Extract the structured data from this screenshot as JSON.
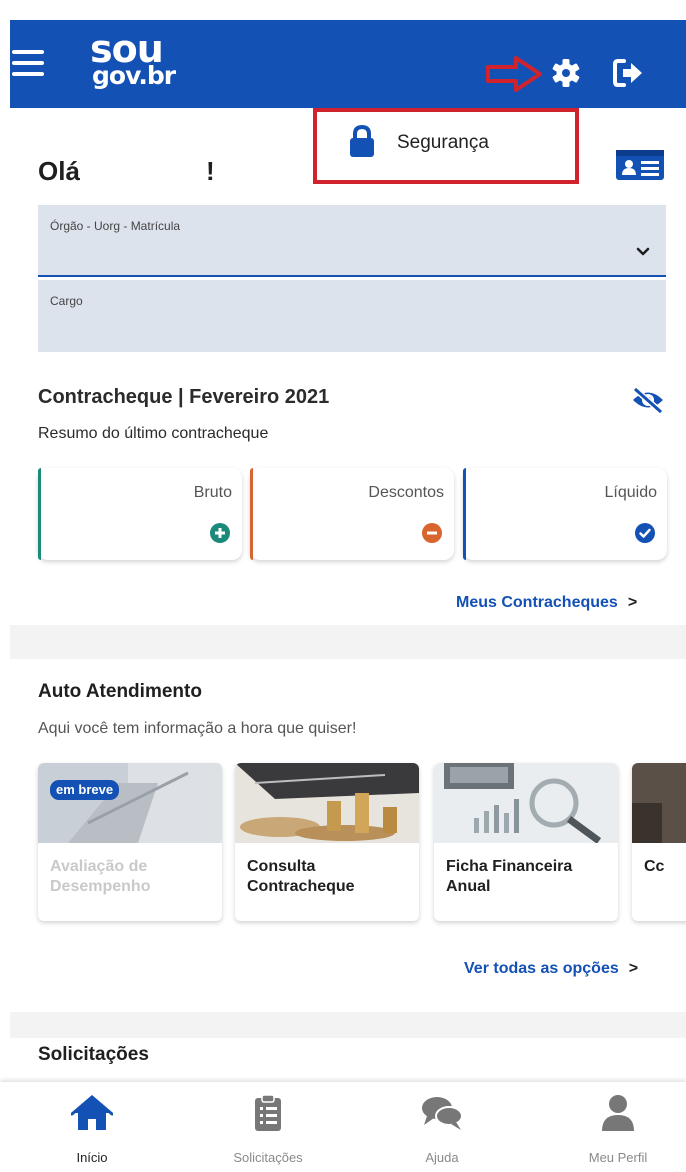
{
  "header": {
    "logo_line1": "sou",
    "logo_line2": "gov.br",
    "menu_icon": "hamburger-menu-icon",
    "settings_icon": "gear-icon",
    "logout_icon": "sign-out-icon",
    "annotation_icon": "red-arrow-icon",
    "brand_color": "#1351b4",
    "annotation_color": "#d1232e"
  },
  "settings_menu": {
    "item_label": "Segurança",
    "item_icon": "lock-icon"
  },
  "greeting": {
    "hello": "Olá",
    "exclamation": "!",
    "card_icon": "id-card-icon"
  },
  "fields": {
    "org_label": "Órgão - Uorg - Matrícula",
    "org_value": "",
    "cargo_label": "Cargo",
    "cargo_value": ""
  },
  "paycheck": {
    "title": "Contracheque | Fevereiro 2021",
    "subtitle": "Resumo do último contracheque",
    "visibility_icon": "eye-slash-icon",
    "cards": [
      {
        "label": "Bruto",
        "icon": "plus-circle-icon",
        "color": "#1c8a7a"
      },
      {
        "label": "Descontos",
        "icon": "minus-circle-icon",
        "color": "#d9652e"
      },
      {
        "label": "Líquido",
        "icon": "check-circle-icon",
        "color": "#1351b4"
      }
    ],
    "link": "Meus Contracheques",
    "link_arrow": ">"
  },
  "self_service": {
    "title": "Auto Atendimento",
    "subtitle": "Aqui você tem informação a hora que quiser!",
    "items": [
      {
        "name": "Avaliação de Desempenho",
        "badge": "em breve"
      },
      {
        "name": "Consulta Contracheque"
      },
      {
        "name": "Ficha Financeira Anual"
      },
      {
        "name": "Cc"
      }
    ],
    "link": "Ver todas as opções",
    "link_arrow": ">"
  },
  "requests": {
    "title": "Solicitações"
  },
  "bottom_nav": {
    "items": [
      {
        "label": "Início",
        "icon": "home-icon",
        "active": true
      },
      {
        "label": "Solicitações",
        "icon": "clipboard-list-icon"
      },
      {
        "label": "Ajuda",
        "icon": "chat-bubbles-icon"
      },
      {
        "label": "Meu Perfil",
        "icon": "user-icon"
      }
    ]
  }
}
